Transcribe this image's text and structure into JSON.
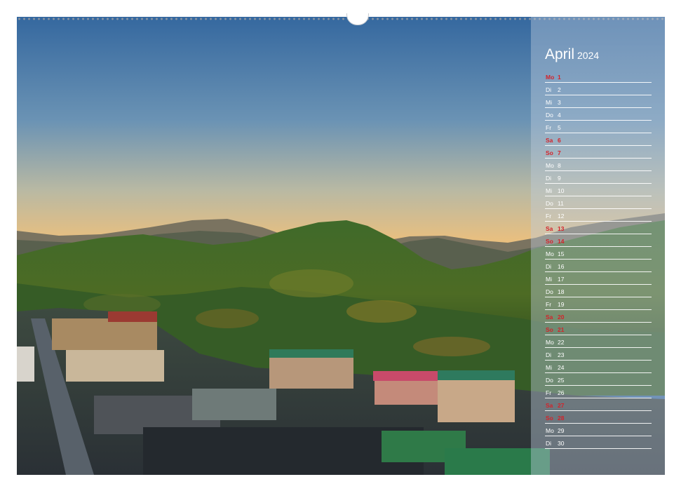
{
  "calendar": {
    "month": "April",
    "year": "2024",
    "days": [
      {
        "wd": "Mo",
        "d": "1",
        "holiday": true
      },
      {
        "wd": "Di",
        "d": "2",
        "holiday": false
      },
      {
        "wd": "Mi",
        "d": "3",
        "holiday": false
      },
      {
        "wd": "Do",
        "d": "4",
        "holiday": false
      },
      {
        "wd": "Fr",
        "d": "5",
        "holiday": false
      },
      {
        "wd": "Sa",
        "d": "6",
        "holiday": true
      },
      {
        "wd": "So",
        "d": "7",
        "holiday": true
      },
      {
        "wd": "Mo",
        "d": "8",
        "holiday": false
      },
      {
        "wd": "Di",
        "d": "9",
        "holiday": false
      },
      {
        "wd": "Mi",
        "d": "10",
        "holiday": false
      },
      {
        "wd": "Do",
        "d": "11",
        "holiday": false
      },
      {
        "wd": "Fr",
        "d": "12",
        "holiday": false
      },
      {
        "wd": "Sa",
        "d": "13",
        "holiday": true
      },
      {
        "wd": "So",
        "d": "14",
        "holiday": true
      },
      {
        "wd": "Mo",
        "d": "15",
        "holiday": false
      },
      {
        "wd": "Di",
        "d": "16",
        "holiday": false
      },
      {
        "wd": "Mi",
        "d": "17",
        "holiday": false
      },
      {
        "wd": "Do",
        "d": "18",
        "holiday": false
      },
      {
        "wd": "Fr",
        "d": "19",
        "holiday": false
      },
      {
        "wd": "Sa",
        "d": "20",
        "holiday": true
      },
      {
        "wd": "So",
        "d": "21",
        "holiday": true
      },
      {
        "wd": "Mo",
        "d": "22",
        "holiday": false
      },
      {
        "wd": "Di",
        "d": "23",
        "holiday": false
      },
      {
        "wd": "Mi",
        "d": "24",
        "holiday": false
      },
      {
        "wd": "Do",
        "d": "25",
        "holiday": false
      },
      {
        "wd": "Fr",
        "d": "26",
        "holiday": false
      },
      {
        "wd": "Sa",
        "d": "27",
        "holiday": true
      },
      {
        "wd": "So",
        "d": "28",
        "holiday": true
      },
      {
        "wd": "Mo",
        "d": "29",
        "holiday": false
      },
      {
        "wd": "Di",
        "d": "30",
        "holiday": false
      }
    ]
  },
  "colors": {
    "weekend": "#d4232a",
    "weekday": "#ffffff",
    "sky_top": "#3a6aa0",
    "sky_bottom": "#e8c890",
    "forest": "#2f5a22"
  }
}
